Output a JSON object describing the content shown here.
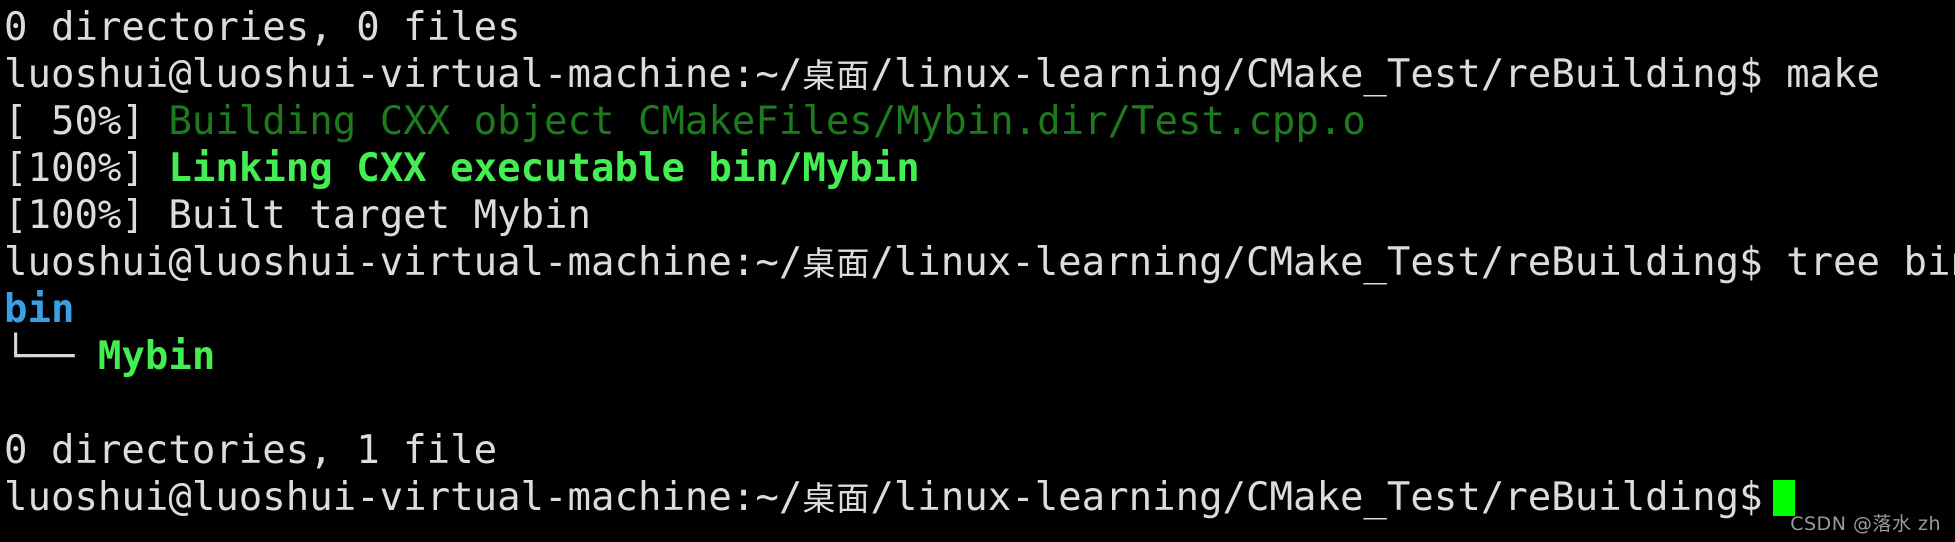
{
  "terminal": {
    "background_color": "#000000",
    "foreground_color": "#dcdcdc",
    "colors": {
      "dim_green": "#1d7a1d",
      "bright_green": "#44ed51",
      "blue": "#3b9fe8",
      "cursor_green": "#00ff00",
      "watermark_gray": "#9a9a9a"
    },
    "prompt": {
      "user_host": "luoshui@luoshui-virtual-machine",
      "separator": ":",
      "path_prefix": "~/",
      "path_cjk": "桌面",
      "path_suffix": "/linux-learning/CMake_Test/reBuilding",
      "sigil": "$"
    },
    "lines": {
      "l1_tree_summary_prev": "0 directories, 0 files",
      "l2_command_make": " make",
      "l3_percent": "[ 50%] ",
      "l3_message": "Building CXX object CMakeFiles/Mybin.dir/Test.cpp.o",
      "l4_percent": "[100%] ",
      "l4_message": "Linking CXX executable bin/Mybin",
      "l5_percent": "[100%] ",
      "l5_message": "Built target Mybin",
      "l6_command_tree": " tree bin",
      "l7_dir": "bin",
      "l8_branch": "└── ",
      "l8_file": "Mybin",
      "l9_blank": "",
      "l10_tree_summary": "0 directories, 1 file",
      "l11_cursor": ""
    },
    "watermark": "CSDN @落水 zh"
  }
}
